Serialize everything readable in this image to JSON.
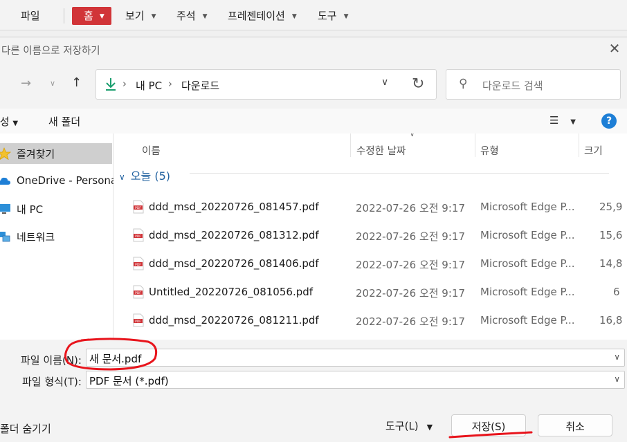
{
  "ribbon": {
    "file": "파일",
    "home": "홈",
    "view": "보기",
    "comment": "주석",
    "presentation": "프레젠테이션",
    "tools": "도구"
  },
  "dialog": {
    "title": "다른 이름으로 저장하기",
    "address": {
      "pc": "내 PC",
      "folder": "다운로드"
    },
    "search_placeholder": "다운로드 검색",
    "organize": "구성",
    "new_folder": "새 폴더"
  },
  "sidebar": {
    "items": [
      {
        "label": "즐겨찾기",
        "icon": "star-icon",
        "selected": true
      },
      {
        "label": "OneDrive - Personal",
        "icon": "cloud-icon"
      },
      {
        "label": "내 PC",
        "icon": "monitor-icon"
      },
      {
        "label": "네트워크",
        "icon": "network-icon"
      }
    ]
  },
  "filelist": {
    "columns": {
      "name": "이름",
      "modified": "수정한 날짜",
      "type": "유형",
      "size": "크기"
    },
    "group": "오늘 (5)",
    "rows": [
      {
        "name": "ddd_msd_20220726_081457.pdf",
        "date": "2022-07-26 오전 9:17",
        "type": "Microsoft Edge P...",
        "size": "25,9"
      },
      {
        "name": "ddd_msd_20220726_081312.pdf",
        "date": "2022-07-26 오전 9:17",
        "type": "Microsoft Edge P...",
        "size": "15,6"
      },
      {
        "name": "ddd_msd_20220726_081406.pdf",
        "date": "2022-07-26 오전 9:17",
        "type": "Microsoft Edge P...",
        "size": "14,8"
      },
      {
        "name": "Untitled_20220726_081056.pdf",
        "date": "2022-07-26 오전 9:17",
        "type": "Microsoft Edge P...",
        "size": "6"
      },
      {
        "name": "ddd_msd_20220726_081211.pdf",
        "date": "2022-07-26 오전 9:17",
        "type": "Microsoft Edge P...",
        "size": "16,8"
      }
    ]
  },
  "form": {
    "filename_label": "파일 이름(N):",
    "filename_value": "새 문서.pdf",
    "filetype_label": "파일 형식(T):",
    "filetype_value": "PDF 문서 (*.pdf)"
  },
  "footer": {
    "hide_folders": "폴더 숨기기",
    "tools": "도구(L)",
    "save": "저장(S)",
    "cancel": "취소"
  },
  "colors": {
    "home_accent": "#d13438",
    "help_blue": "#1e7fd6",
    "annotation_red": "#e8141c"
  }
}
